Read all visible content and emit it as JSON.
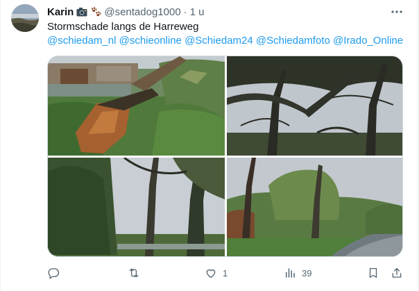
{
  "tweet": {
    "author_name": "Karin",
    "author_emoji": [
      "camera-icon",
      "paw-prints-icon"
    ],
    "handle": "@sentadog1000",
    "separator": "·",
    "time": "1 u",
    "text": "Stormschade langs de Harreweg",
    "mentions": [
      "@schiedam_nl",
      "@schieonline",
      "@Schiedam24",
      "@Schiedamfoto",
      "@Irado_Online"
    ]
  },
  "media": {
    "count": 4,
    "photos": [
      "uprooted-tree-by-canal",
      "bare-trees-against-grey-sky",
      "trees-along-footpath",
      "flooded-path-with-trees"
    ]
  },
  "actions": {
    "reply_count": "",
    "retweet_count": "",
    "like_count": "1",
    "views_count": "39"
  },
  "colors": {
    "text": "#0f1419",
    "secondary": "#536471",
    "link": "#1d9bf0",
    "border": "#cfd9de"
  }
}
